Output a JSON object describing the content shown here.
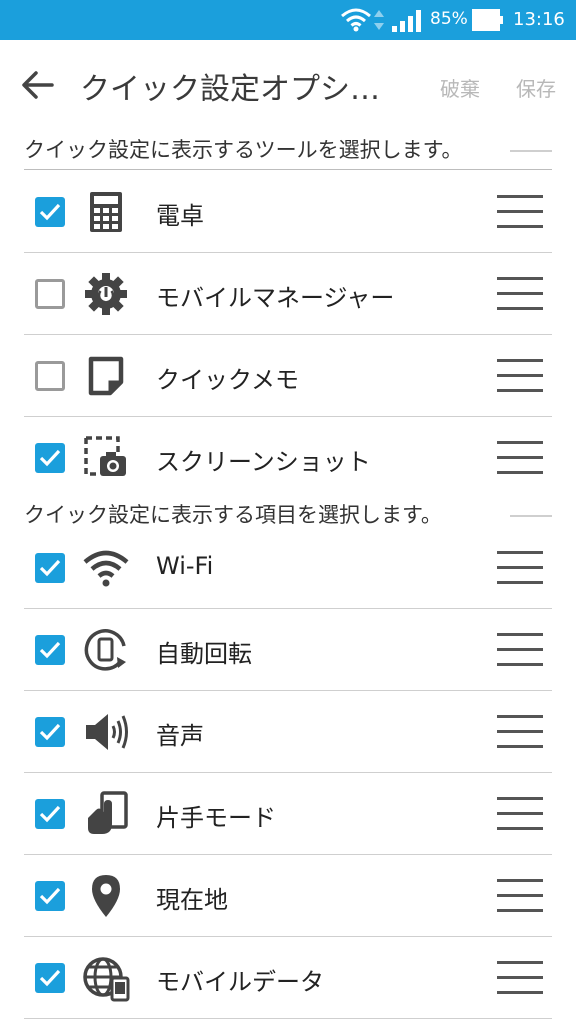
{
  "status_bar": {
    "battery": "85%",
    "time": "13:16"
  },
  "toolbar": {
    "title": "クイック設定オプシ…",
    "discard_label": "破棄",
    "save_label": "保存"
  },
  "sections": [
    {
      "header": "クイック設定に表示するツールを選択します。",
      "items": [
        {
          "label": "電卓",
          "icon": "calculator-icon",
          "checked": true
        },
        {
          "label": "モバイルマネージャー",
          "icon": "gear-icon",
          "checked": false
        },
        {
          "label": "クイックメモ",
          "icon": "memo-icon",
          "checked": false
        },
        {
          "label": "スクリーンショット",
          "icon": "screenshot-icon",
          "checked": true
        }
      ]
    },
    {
      "header": "クイック設定に表示する項目を選択します。",
      "items": [
        {
          "label": "Wi-Fi",
          "icon": "wifi-icon",
          "checked": true
        },
        {
          "label": "自動回転",
          "icon": "auto-rotate-icon",
          "checked": true
        },
        {
          "label": "音声",
          "icon": "volume-icon",
          "checked": true
        },
        {
          "label": "片手モード",
          "icon": "one-hand-mode-icon",
          "checked": true
        },
        {
          "label": "現在地",
          "icon": "location-pin-icon",
          "checked": true
        },
        {
          "label": "モバイルデータ",
          "icon": "mobile-data-icon",
          "checked": true
        }
      ]
    }
  ],
  "colors": {
    "accent": "#1b9fdc",
    "icon": "#444444",
    "disabled_text": "#b8b8b8"
  }
}
